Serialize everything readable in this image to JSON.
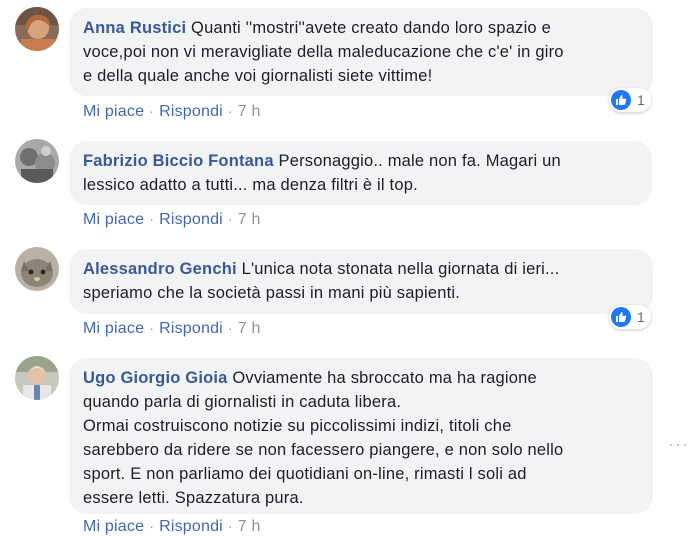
{
  "comments": [
    {
      "author": "Anna Rustici",
      "text": "Quanti ''mostri''avete creato dando loro spazio e\nvoce,poi non vi meravigliate della maleducazione che c'e' in giro\ne della quale anche voi giornalisti siete vittime!",
      "like": "Mi piace",
      "reply": "Rispondi",
      "time": "7 h",
      "reaction_count": "1",
      "avatar_icon": "profile-photo"
    },
    {
      "author": "Fabrizio Biccio Fontana",
      "text": "Personaggio.. male non fa. Magari un\nlessico adatto a tutti... ma denza filtri è il top.",
      "like": "Mi piace",
      "reply": "Rispondi",
      "time": "7 h",
      "avatar_icon": "profile-photo"
    },
    {
      "author": "Alessandro Genchi",
      "text": "L'unica nota stonata nella giornata di ieri...\nsperiamo che la società passi in mani più sapienti.",
      "like": "Mi piace",
      "reply": "Rispondi",
      "time": "7 h",
      "reaction_count": "1",
      "avatar_icon": "profile-photo"
    },
    {
      "author": "Ugo Giorgio Gioia",
      "text": "Ovviamente ha sbroccato ma ha ragione\nquando parla di giornalisti in caduta libera.\nOrmai costruiscono notizie su piccolissimi indizi, titoli che\nsarebbero da ridere se non facessero piangere, e non solo nello\nsport. E non parliamo dei quotidiani on-line, rimasti l soli ad\nessere letti. Spazzatura pura.",
      "like": "Mi piace",
      "reply": "Rispondi",
      "time": "7 h",
      "avatar_icon": "profile-photo"
    }
  ],
  "ui": {
    "separator": "·",
    "more_icon": "more-horizontal-icon",
    "more_glyph": "···"
  },
  "colors": {
    "author": "#385898",
    "link": "#4267b2",
    "bubble": "#f2f3f5",
    "like_blue": "#2078f4",
    "muted": "#90949c"
  }
}
